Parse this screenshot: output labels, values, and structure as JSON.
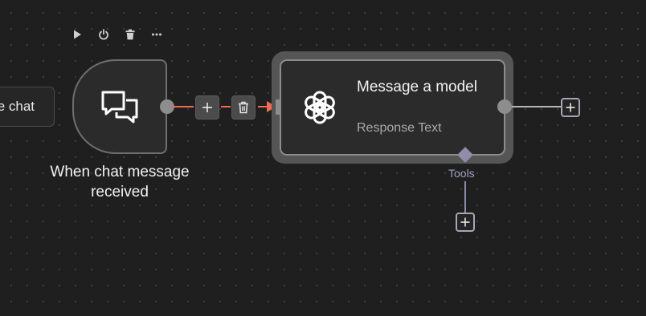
{
  "toolbar": {
    "icons": [
      "play-icon",
      "power-icon",
      "trash-icon",
      "more-icon"
    ]
  },
  "partial_node": {
    "label": "e chat"
  },
  "trigger_node": {
    "label": "When chat message received",
    "icon": "chat-bubbles-icon"
  },
  "edge": {
    "add_icon": "plus-icon",
    "delete_icon": "trash-icon",
    "color": "#ee6a52"
  },
  "model_node": {
    "title": "Message a model",
    "subtitle": "Response Text",
    "icon": "openai-icon"
  },
  "tools": {
    "label": "Tools"
  }
}
